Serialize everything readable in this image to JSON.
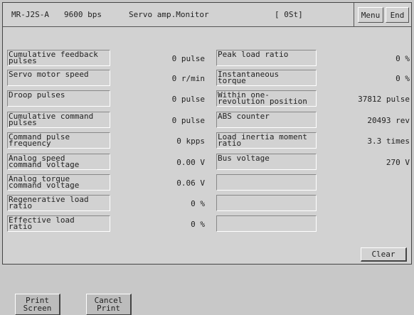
{
  "header": {
    "model": "MR-J2S-A",
    "baud": "9600 bps",
    "title": "Servo amp.Monitor",
    "status": "[ 0St]",
    "menu_label": "Menu",
    "end_label": "End"
  },
  "left_items": [
    {
      "label": "Cumulative feedback\npulses",
      "value": "0 pulse"
    },
    {
      "label": "Servo motor speed",
      "value": "0 r/min"
    },
    {
      "label": "Droop pulses",
      "value": "0 pulse"
    },
    {
      "label": "Cumulative command\npulses",
      "value": "0 pulse"
    },
    {
      "label": "Command pulse\nfrequency",
      "value": "0 kpps"
    },
    {
      "label": "Analog speed\ncommand voltage",
      "value": "0.00 V"
    },
    {
      "label": "Analog torque\ncommand voltage",
      "value": "0.06 V"
    },
    {
      "label": "Regenerative load\nratio",
      "value": "0 %"
    },
    {
      "label": "Effective load\nratio",
      "value": "0 %"
    }
  ],
  "right_items": [
    {
      "label": "Peak load ratio",
      "value": "0 %"
    },
    {
      "label": "Instantaneous\ntorque",
      "value": "0 %"
    },
    {
      "label": "Within one-\nrevolution position",
      "value": "37812 pulse"
    },
    {
      "label": "ABS counter",
      "value": "20493 rev"
    },
    {
      "label": "Load inertia moment\nratio",
      "value": "3.3 times"
    },
    {
      "label": "Bus voltage",
      "value": "270 V"
    },
    {
      "label": "",
      "value": ""
    },
    {
      "label": "",
      "value": ""
    },
    {
      "label": "",
      "value": ""
    }
  ],
  "clear_label": "Clear",
  "bottom": {
    "print_screen": "Print\nScreen",
    "cancel_print": "Cancel\nPrint"
  }
}
